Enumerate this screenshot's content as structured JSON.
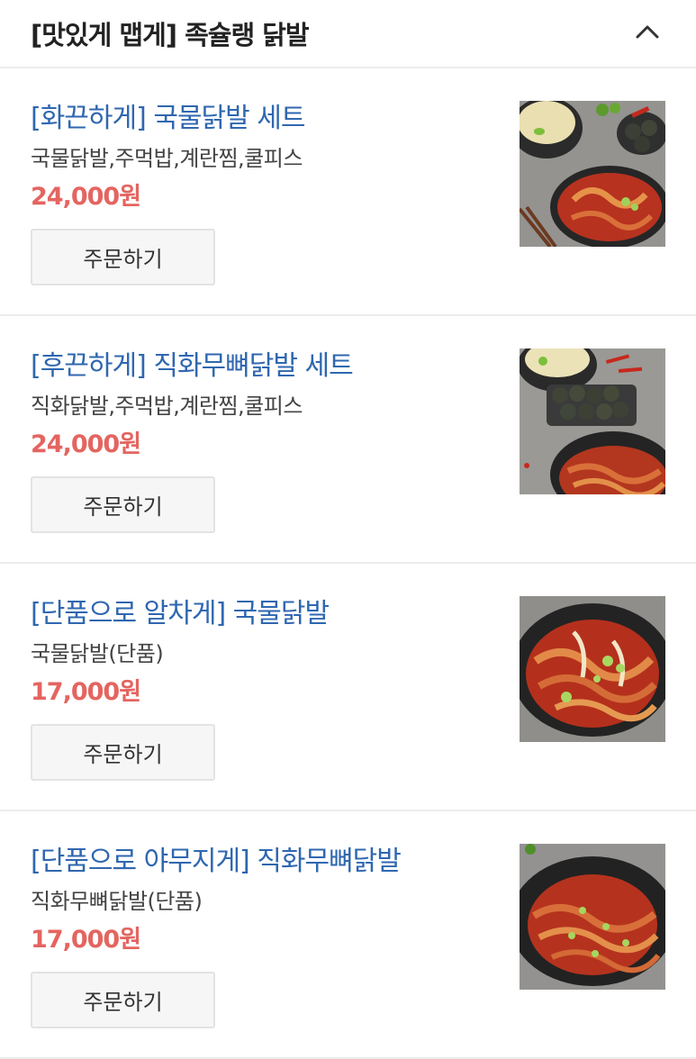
{
  "header": {
    "title": "[맛있게 맵게] 족슐랭 닭발",
    "collapse_icon": "chevron-up-icon"
  },
  "items": [
    {
      "name": "[화끈하게] 국물닭발 세트",
      "desc": "국물닭발,주먹밥,계란찜,쿨피스",
      "price": "24,000원",
      "order_label": "주문하기",
      "image": "spicy-soup-chicken-feet-set-photo"
    },
    {
      "name": "[후끈하게] 직화무뼈닭발 세트",
      "desc": "직화닭발,주먹밥,계란찜,쿨피스",
      "price": "24,000원",
      "order_label": "주문하기",
      "image": "grilled-boneless-chicken-feet-set-photo"
    },
    {
      "name": "[단품으로 알차게] 국물닭발",
      "desc": "국물닭발(단품)",
      "price": "17,000원",
      "order_label": "주문하기",
      "image": "soup-chicken-feet-photo"
    },
    {
      "name": "[단품으로 야무지게] 직화무뼈닭발",
      "desc": "직화무뼈닭발(단품)",
      "price": "17,000원",
      "order_label": "주문하기",
      "image": "grilled-boneless-chicken-feet-photo"
    }
  ],
  "colors": {
    "item_name": "#2f67b0",
    "price": "#e46560",
    "divider": "#ececec",
    "button_bg": "#f6f6f7"
  }
}
